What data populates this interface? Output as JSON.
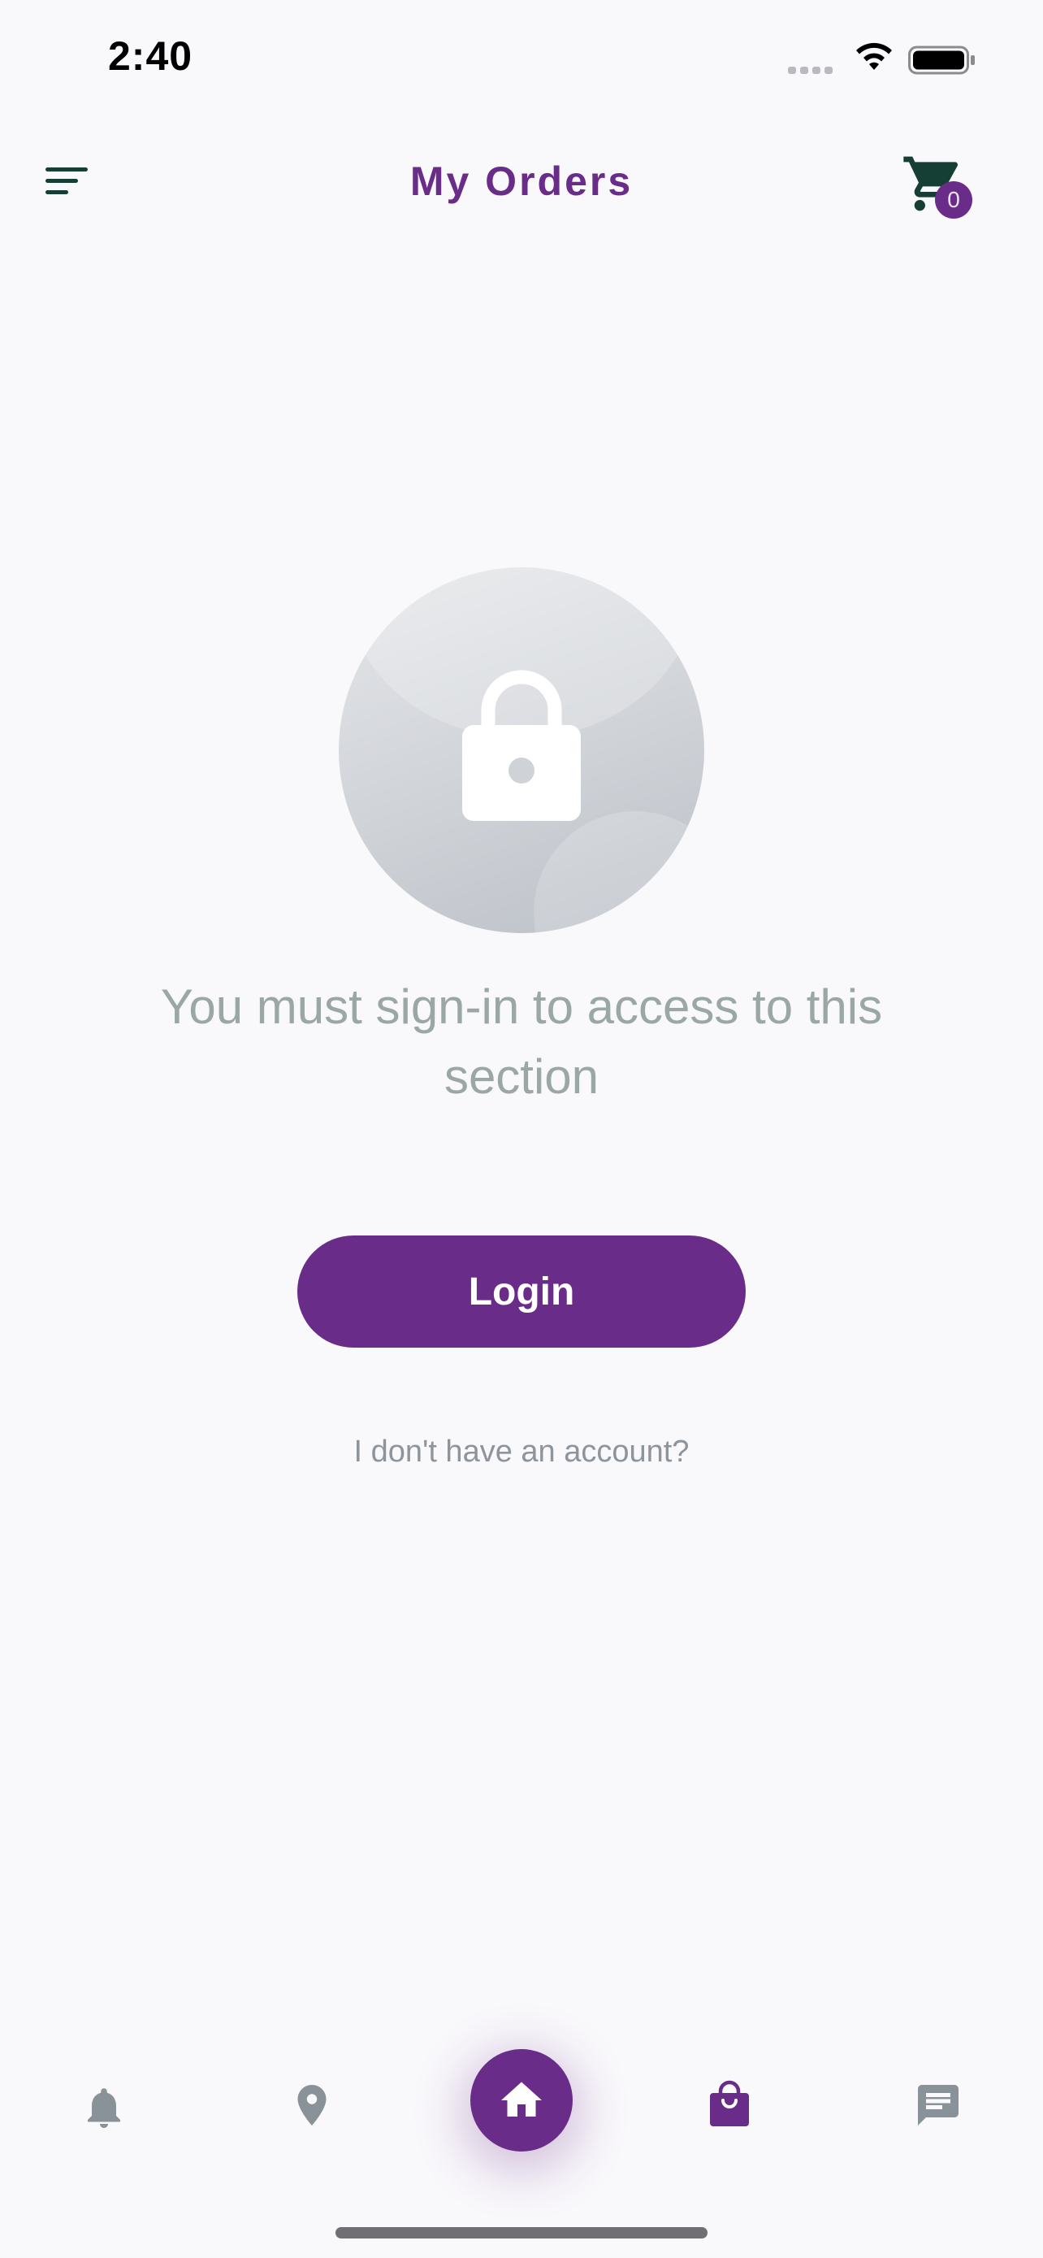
{
  "status_bar": {
    "time": "2:40"
  },
  "header": {
    "title": "My Orders",
    "cart_count": "0"
  },
  "empty_state": {
    "message": "You must sign-in to access to this section",
    "login_label": "Login",
    "no_account_label": "I don't have an account?"
  },
  "bottom_nav": {
    "items": [
      {
        "icon": "bell-icon",
        "active": false
      },
      {
        "icon": "location-pin-icon",
        "active": false
      },
      {
        "icon": "home-icon",
        "active": false
      },
      {
        "icon": "shopping-bag-icon",
        "active": true
      },
      {
        "icon": "chat-icon",
        "active": false
      }
    ]
  },
  "colors": {
    "brand": "#6a2c89",
    "background": "#f9f8fb",
    "nav_inactive": "#8a9299",
    "message_text": "#9aa7a4",
    "menu_icon": "#153e34"
  }
}
